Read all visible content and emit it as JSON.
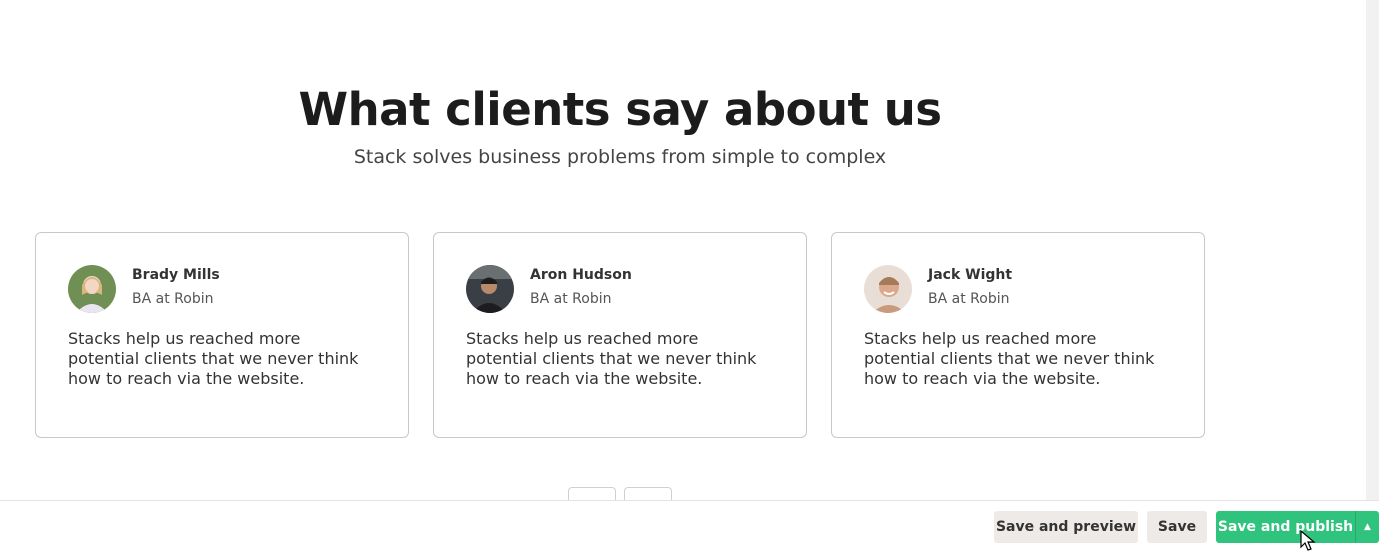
{
  "section": {
    "title": "What clients say about us",
    "subtitle": "Stack solves business problems from simple to complex"
  },
  "testimonials": [
    {
      "name": "Brady Mills",
      "role": "BA at Robin",
      "quote": "Stacks help us reached more potential clients that we never think how to reach via the website."
    },
    {
      "name": "Aron Hudson",
      "role": "BA at Robin",
      "quote": "Stacks help us reached more potential clients that we never think how to reach via the website."
    },
    {
      "name": "Jack Wight",
      "role": "BA at Robin",
      "quote": "Stacks help us reached more potential clients that we never think how to reach via the website."
    }
  ],
  "footer": {
    "save_preview_label": "Save and preview",
    "save_label": "Save",
    "save_publish_label": "Save and publish",
    "caret_icon": "caret-up-icon"
  },
  "colors": {
    "accent": "#30c37d",
    "secondary_button": "#eeeae8"
  }
}
